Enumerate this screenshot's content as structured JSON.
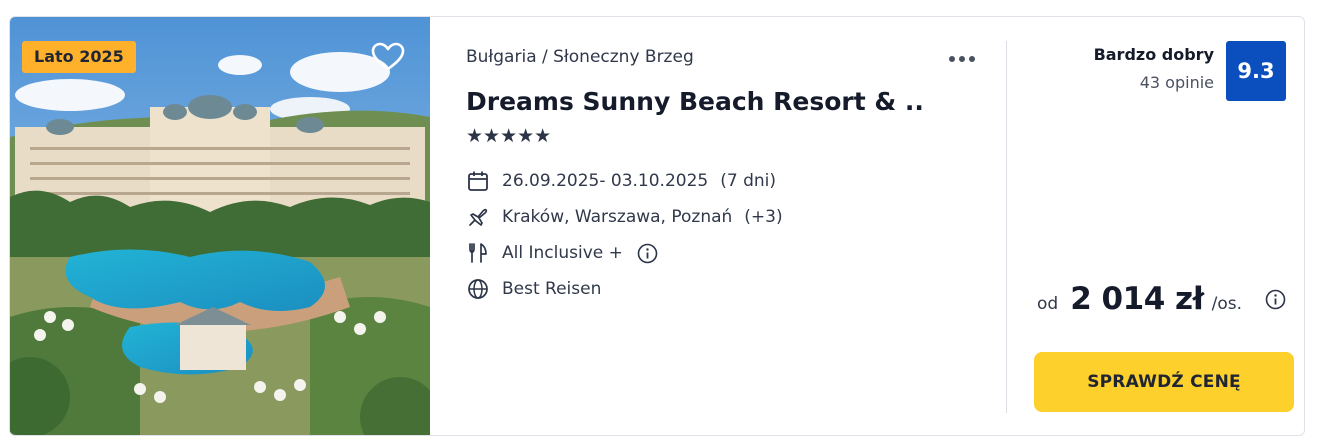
{
  "offer": {
    "season_badge": "Lato 2025",
    "location": "Bułgaria / Słoneczny Brzeg",
    "hotel_name": "Dreams Sunny Beach Resort & ...",
    "star_rating": 5,
    "stars_glyph": "★★★★★",
    "dates": "26.09.2025- 03.10.2025",
    "duration": "(7 dni)",
    "airports": "Kraków, Warszawa, Poznań",
    "airports_more": "(+3)",
    "board": "All Inclusive +",
    "operator": "Best Reisen"
  },
  "rating": {
    "label": "Bardzo dobry",
    "count": "43 opinie",
    "score": "9.3",
    "color": "#0b4fbf"
  },
  "price": {
    "prefix": "od",
    "value": "2 014 zł",
    "unit": "/os."
  },
  "cta": {
    "label": "SPRAWDŹ CENĘ",
    "color": "#fdd02b"
  },
  "badge_color": "#ffb12c",
  "icons": {
    "favorite": "heart-icon",
    "more": "more-dots-icon",
    "dates": "calendar-icon",
    "airports": "plane-icon",
    "board": "cutlery-icon",
    "board_info": "info-icon",
    "operator": "globe-icon",
    "price_info": "info-icon"
  }
}
